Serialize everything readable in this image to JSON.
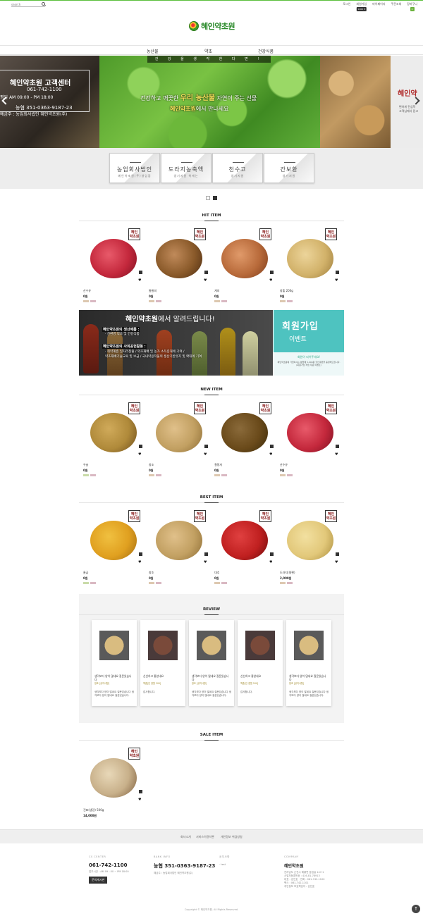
{
  "topbar": {
    "search_placeholder": "search",
    "menu": [
      {
        "label": "로그인"
      },
      {
        "label": "회원가입",
        "badge": "1000 P"
      },
      {
        "label": "마이페이지"
      },
      {
        "label": "주문조회"
      },
      {
        "label": "장바구니",
        "badge": "0"
      }
    ]
  },
  "logo": {
    "text": "혜인약초원"
  },
  "gnb": [
    "농산물",
    "약초",
    "건강식품"
  ],
  "banner": {
    "left": {
      "title": "혜인약초원 고객센터",
      "phone": "061-742-1100",
      "hours": "평일 AM 09:00 - PM 18:00",
      "bank": "농협 351-0363-9187-23",
      "holder": "예금주 : 농업회사법인 혜인약초원(주)"
    },
    "strip": "건 강 을 생 각 한 다 면 !",
    "line1_a": "건강하고 깨끗한",
    "line1_b": "우리 농산물",
    "line1_c": "자연이 주는 선물",
    "line2_a": "혜인약초원",
    "line2_b": "에서 만나세요",
    "right": {
      "title": "혜인약",
      "sub1": "편하게 전심학",
      "sub2": "고객님께서 믿고"
    }
  },
  "categories": [
    {
      "name": "농업회사법인",
      "sub": "혜인약초원(주)영업점"
    },
    {
      "name": "도라지농축액",
      "sub": "생기지원 착계는"
    },
    {
      "name": "천수고",
      "sub": "생기지원"
    },
    {
      "name": "간보환",
      "sub": "생기지원"
    }
  ],
  "stamp": "혜인\n약초원",
  "hit": {
    "heading": "HIT ITEM",
    "items": [
      {
        "name": "산수유",
        "price": "0원",
        "color": "#c4283c"
      },
      {
        "name": "통율피",
        "price": "0원",
        "color": "#8a5a2a"
      },
      {
        "name": "계피",
        "price": "0원",
        "color": "#b86a3a"
      },
      {
        "name": "창출 200g",
        "price": "0원",
        "color": "#d2b26a"
      }
    ]
  },
  "notice": {
    "title_bold": "혜인약초원",
    "title_rest": "에서 알려드립니다!",
    "head1": "혜인약초원의 생산제품 :",
    "item1": "· 친환경 약초 및 건강식품",
    "head2": "혜인약초원의 사회공헌활동 :",
    "item2": "· 취약계층 일자리창출 / 약초재배 및 농가 소득증대에 기여 /",
    "item3": "약초재배기술교육 및 보급 / 국내약용작물의 생산기반유지 및 확대에 기여"
  },
  "event": {
    "title": "회원가입",
    "sub": "이벤트",
    "caption": "회원이 되어주세요!",
    "desc": "혜인약초원에 가입하시는 분들께 5,000원 할인쿠폰을 증정해드립니다. (회원가입 적립 무료 이벤트)"
  },
  "newi": {
    "heading": "NEW ITEM",
    "items": [
      {
        "name": "우슬",
        "price": "0원",
        "color": "#b08a3a"
      },
      {
        "name": "창조",
        "price": "0원",
        "color": "#c2a062"
      },
      {
        "name": "결명자",
        "price": "0원",
        "color": "#6a4a1a"
      },
      {
        "name": "산수유",
        "price": "0원",
        "color": "#c4283c"
      }
    ]
  },
  "best": {
    "heading": "BEST ITEM",
    "items": [
      {
        "name": "울금",
        "price": "0원",
        "color": "#e0a020"
      },
      {
        "name": "창조",
        "price": "0원",
        "color": "#c2a062"
      },
      {
        "name": "대추",
        "price": "0원",
        "color": "#c02020"
      },
      {
        "name": "도라지(절편)",
        "price": "2,000원",
        "color": "#e2c87a"
      }
    ]
  },
  "review": {
    "heading": "REVIEW",
    "cards": [
      {
        "title": "생각보다 양이 많네요 질문있습니다",
        "meta": "창조 [공지사항]",
        "body": "생각보다 양이 많네요 질문있습니다 생각보다 양이 많네요 질문있습니다.",
        "img": "#c9a86a"
      },
      {
        "title": "신선하고 좋았네요",
        "meta": "백출[안 경원 200]",
        "body": "감사합니다.",
        "img": "#6a3a2a"
      },
      {
        "title": "생각보다 양이 많네요 질문있습니다",
        "meta": "창조 [공지사항]",
        "body": "생각보다 양이 많네요 질문있습니다 생각보다 양이 많네요 질문있습니다.",
        "img": "#c9a86a"
      },
      {
        "title": "신선하고 좋았네요",
        "meta": "백출[안 경원 200]",
        "body": "감사합니다.",
        "img": "#6a3a2a"
      },
      {
        "title": "생각보다 양이 많네요 질문있습니다",
        "meta": "창조 [공지사항]",
        "body": "생각보다 양이 많네요 질문있습니다 생각보다 양이 많네요 질문있습니다.",
        "img": "#c9a86a"
      }
    ]
  },
  "sale": {
    "heading": "SALE ITEM",
    "items": [
      {
        "name": "건표(생강) 500g",
        "price": "14,000원",
        "color": "#c8b08a"
      }
    ]
  },
  "footer": {
    "links": [
      "회사소개",
      "서비스이용약관",
      "개인정보 취급방침"
    ],
    "cs_cap": "CS CENTER",
    "cs_phone": "061-742-1100",
    "cs_hours": "업무시간 : AM 09 : 00 ~ PM 18:00",
    "cs_btn": "문의게시판",
    "bank_cap": "BANK INFO",
    "bank_no": "농협 351-0363-9187-23",
    "bank_holder": "예금주 : 농업회사법인 혜인약초원(주)",
    "board_cap": "공지사항",
    "board_item": "· test",
    "company_cap": "COMPANY",
    "company_name": "혜인약초원",
    "company_info": "전라남도 순천시 해룡면 동림길 147-1",
    "company_info2": "사업자등록번호 : 416-81-78913",
    "company_info3": "대표 : 김인호 · 전화 : 061-742-1100",
    "company_info4": "팩스 : 061-742-1101",
    "company_info5": "개인정보 보호책임자 : 김인호",
    "copyright": "Copyright © 혜인약초원. All Rights Reserved."
  }
}
